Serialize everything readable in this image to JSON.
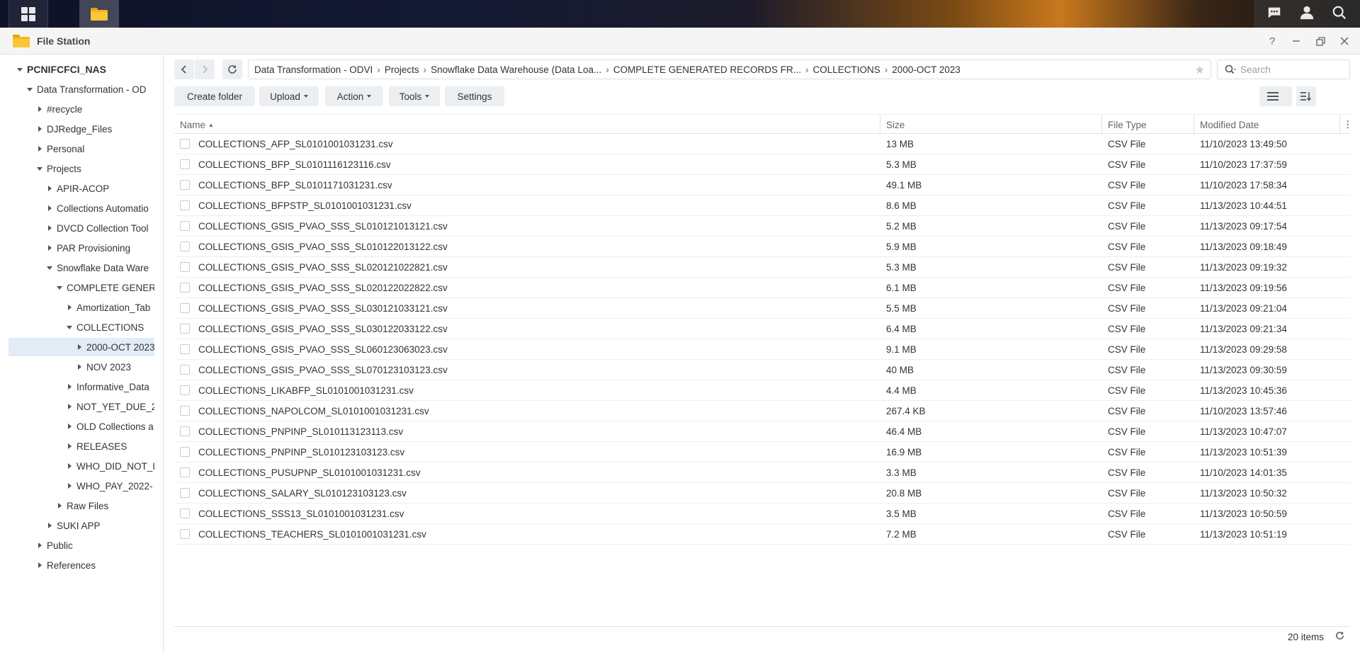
{
  "window": {
    "title": "File Station"
  },
  "sidebar": {
    "items": [
      {
        "label": "PCNIFCFCI_NAS",
        "level": 0,
        "state": "open",
        "root": true
      },
      {
        "label": "Data Transformation - OD",
        "level": 1,
        "state": "open"
      },
      {
        "label": "#recycle",
        "level": 2,
        "state": "closed"
      },
      {
        "label": "DJRedge_Files",
        "level": 2,
        "state": "closed"
      },
      {
        "label": "Personal",
        "level": 2,
        "state": "closed"
      },
      {
        "label": "Projects",
        "level": 2,
        "state": "open"
      },
      {
        "label": "APIR-ACOP",
        "level": 3,
        "state": "closed"
      },
      {
        "label": "Collections Automatio",
        "level": 3,
        "state": "closed"
      },
      {
        "label": "DVCD Collection Tool",
        "level": 3,
        "state": "closed"
      },
      {
        "label": "PAR Provisioning",
        "level": 3,
        "state": "closed"
      },
      {
        "label": "Snowflake Data Ware",
        "level": 3,
        "state": "open"
      },
      {
        "label": "COMPLETE GENERA",
        "level": 4,
        "state": "open"
      },
      {
        "label": "Amortization_Tab",
        "level": 5,
        "state": "closed"
      },
      {
        "label": "COLLECTIONS",
        "level": 5,
        "state": "open"
      },
      {
        "label": "2000-OCT 2023",
        "level": 6,
        "state": "closed",
        "selected": true
      },
      {
        "label": "NOV 2023",
        "level": 6,
        "state": "closed"
      },
      {
        "label": "Informative_Data",
        "level": 5,
        "state": "closed"
      },
      {
        "label": "NOT_YET_DUE_2",
        "level": 5,
        "state": "closed"
      },
      {
        "label": "OLD Collections a",
        "level": 5,
        "state": "closed"
      },
      {
        "label": "RELEASES",
        "level": 5,
        "state": "closed"
      },
      {
        "label": "WHO_DID_NOT_I",
        "level": 5,
        "state": "closed"
      },
      {
        "label": "WHO_PAY_2022-",
        "level": 5,
        "state": "closed"
      },
      {
        "label": "Raw Files",
        "level": 4,
        "state": "closed"
      },
      {
        "label": "SUKI APP",
        "level": 3,
        "state": "closed"
      },
      {
        "label": "Public",
        "level": 2,
        "state": "closed"
      },
      {
        "label": "References",
        "level": 2,
        "state": "closed"
      }
    ]
  },
  "path": {
    "crumbs": [
      "Data Transformation - ODVI",
      "Projects",
      "Snowflake Data Warehouse (Data Loa...",
      "COMPLETE GENERATED RECORDS FR...",
      "COLLECTIONS",
      "2000-OCT 2023"
    ],
    "separator": "›"
  },
  "search": {
    "placeholder": "Search"
  },
  "toolbar": {
    "create_folder": "Create folder",
    "upload": "Upload",
    "action": "Action",
    "tools": "Tools",
    "settings": "Settings"
  },
  "table": {
    "headers": {
      "name": "Name",
      "size": "Size",
      "type": "File Type",
      "modified": "Modified Date"
    },
    "rows": [
      {
        "name": "COLLECTIONS_AFP_SL0101001031231.csv",
        "size": "13 MB",
        "type": "CSV File",
        "modified": "11/10/2023 13:49:50"
      },
      {
        "name": "COLLECTIONS_BFP_SL0101116123116.csv",
        "size": "5.3 MB",
        "type": "CSV File",
        "modified": "11/10/2023 17:37:59"
      },
      {
        "name": "COLLECTIONS_BFP_SL0101171031231.csv",
        "size": "49.1 MB",
        "type": "CSV File",
        "modified": "11/10/2023 17:58:34"
      },
      {
        "name": "COLLECTIONS_BFPSTP_SL0101001031231.csv",
        "size": "8.6 MB",
        "type": "CSV File",
        "modified": "11/13/2023 10:44:51"
      },
      {
        "name": "COLLECTIONS_GSIS_PVAO_SSS_SL010121013121.csv",
        "size": "5.2 MB",
        "type": "CSV File",
        "modified": "11/13/2023 09:17:54"
      },
      {
        "name": "COLLECTIONS_GSIS_PVAO_SSS_SL010122013122.csv",
        "size": "5.9 MB",
        "type": "CSV File",
        "modified": "11/13/2023 09:18:49"
      },
      {
        "name": "COLLECTIONS_GSIS_PVAO_SSS_SL020121022821.csv",
        "size": "5.3 MB",
        "type": "CSV File",
        "modified": "11/13/2023 09:19:32"
      },
      {
        "name": "COLLECTIONS_GSIS_PVAO_SSS_SL020122022822.csv",
        "size": "6.1 MB",
        "type": "CSV File",
        "modified": "11/13/2023 09:19:56"
      },
      {
        "name": "COLLECTIONS_GSIS_PVAO_SSS_SL030121033121.csv",
        "size": "5.5 MB",
        "type": "CSV File",
        "modified": "11/13/2023 09:21:04"
      },
      {
        "name": "COLLECTIONS_GSIS_PVAO_SSS_SL030122033122.csv",
        "size": "6.4 MB",
        "type": "CSV File",
        "modified": "11/13/2023 09:21:34"
      },
      {
        "name": "COLLECTIONS_GSIS_PVAO_SSS_SL060123063023.csv",
        "size": "9.1 MB",
        "type": "CSV File",
        "modified": "11/13/2023 09:29:58"
      },
      {
        "name": "COLLECTIONS_GSIS_PVAO_SSS_SL070123103123.csv",
        "size": "40 MB",
        "type": "CSV File",
        "modified": "11/13/2023 09:30:59"
      },
      {
        "name": "COLLECTIONS_LIKABFP_SL0101001031231.csv",
        "size": "4.4 MB",
        "type": "CSV File",
        "modified": "11/13/2023 10:45:36"
      },
      {
        "name": "COLLECTIONS_NAPOLCOM_SL0101001031231.csv",
        "size": "267.4 KB",
        "type": "CSV File",
        "modified": "11/10/2023 13:57:46"
      },
      {
        "name": "COLLECTIONS_PNPINP_SL010113123113.csv",
        "size": "46.4 MB",
        "type": "CSV File",
        "modified": "11/13/2023 10:47:07"
      },
      {
        "name": "COLLECTIONS_PNPINP_SL010123103123.csv",
        "size": "16.9 MB",
        "type": "CSV File",
        "modified": "11/13/2023 10:51:39"
      },
      {
        "name": "COLLECTIONS_PUSUPNP_SL0101001031231.csv",
        "size": "3.3 MB",
        "type": "CSV File",
        "modified": "11/10/2023 14:01:35"
      },
      {
        "name": "COLLECTIONS_SALARY_SL010123103123.csv",
        "size": "20.8 MB",
        "type": "CSV File",
        "modified": "11/13/2023 10:50:32"
      },
      {
        "name": "COLLECTIONS_SSS13_SL0101001031231.csv",
        "size": "3.5 MB",
        "type": "CSV File",
        "modified": "11/13/2023 10:50:59"
      },
      {
        "name": "COLLECTIONS_TEACHERS_SL0101001031231.csv",
        "size": "7.2 MB",
        "type": "CSV File",
        "modified": "11/13/2023 10:51:19"
      }
    ]
  },
  "status": {
    "count": "20 items"
  },
  "icons": {
    "taskbar": [
      "apps-grid-icon",
      "file-station-icon",
      "chat-icon",
      "user-icon",
      "search-icon"
    ],
    "window": [
      "help-icon",
      "minimize-icon",
      "restore-icon",
      "close-icon"
    ]
  },
  "colors": {
    "selected_bg": "#e1ecf7",
    "folder": "#f8b418",
    "button_bg": "#eceff2"
  }
}
